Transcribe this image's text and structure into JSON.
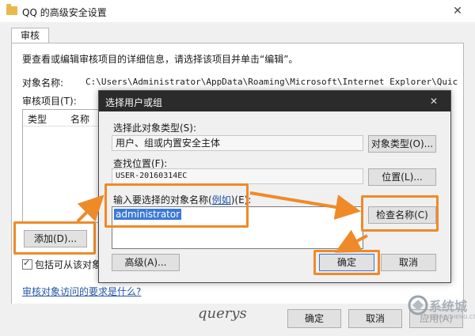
{
  "window": {
    "title": "QQ 的高级安全设置",
    "close_glyph": "✕",
    "tab": "审核",
    "description": "要查看或编辑审核项目的详细信息，请选择该项目并单击“编辑”。",
    "object_name_label": "对象名称:",
    "object_name_value": "C:\\Users\\Administrator\\AppData\\Roaming\\Microsoft\\Internet Explorer\\Quick Launch\\Use",
    "audit_items_label": "审核项目(T):",
    "columns": [
      "类型",
      "名称"
    ],
    "add_button": "添加(D)...",
    "include_checkbox_label": "包括可从该对象的",
    "help_link": "审核对象访问的要求是什么?",
    "footer_buttons": [
      "确定",
      "取消",
      "应用(A)"
    ],
    "signature": "querys"
  },
  "dialog": {
    "title": "选择用户或组",
    "close_glyph": "✕",
    "object_type_label": "选择此对象类型(S):",
    "object_type_value": "用户、组或内置安全主体",
    "object_type_button": "对象类型(O)...",
    "location_label": "查找位置(F):",
    "location_value": "USER-20160314EC",
    "location_button": "位置(L)...",
    "enter_names_label_pre": "输入要选择的对象名称(",
    "enter_names_link": "例如",
    "enter_names_label_post": ")(E):",
    "enter_names_value": "administrator",
    "check_names_button": "检查名称(C)",
    "advanced_button": "高级(A)...",
    "ok_button": "确定",
    "cancel_button": "取消"
  },
  "watermark": {
    "brand": "系统城",
    "url": "XITONGCHENG.COM"
  },
  "colors": {
    "annotation": "#ef8a28",
    "selection": "#3b78d8",
    "dialog_titlebar": "#2b2b2b",
    "link": "#2456a6"
  }
}
